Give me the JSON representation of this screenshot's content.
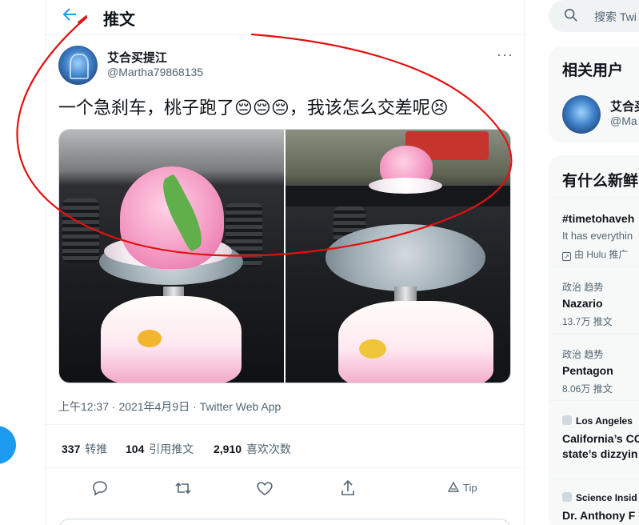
{
  "header": {
    "title": "推文"
  },
  "tweet": {
    "author_name": "艾合买提江",
    "author_handle": "@Martha79868135",
    "more_label": "···",
    "text": "一个急刹车，桃子跑了😔😔😔，我该怎么交差呢😣",
    "timestamp": "上午12:37 · 2021年4月9日 · Twitter Web App",
    "stats": {
      "retweets_value": "337",
      "retweets_label": "转推",
      "quotes_value": "104",
      "quotes_label": "引用推文",
      "likes_value": "2,910",
      "likes_label": "喜欢次数"
    },
    "actions": {
      "reply_icon": "reply-icon",
      "retweet_icon": "retweet-icon",
      "like_icon": "heart-icon",
      "share_icon": "share-icon",
      "tip_label": "Tip"
    }
  },
  "sidebar": {
    "search_placeholder": "搜索 Twi",
    "related_title": "相关用户",
    "related_user": {
      "name": "艾合买",
      "handle": "@Ma"
    },
    "trends_title": "有什么新鲜",
    "trends": [
      {
        "title": "#timetohaveh",
        "sub": "It has everythin",
        "promo": "由 Hulu 推广"
      },
      {
        "meta": "政治 趋势",
        "title": "Nazario",
        "sub": "13.7万 推文"
      },
      {
        "meta": "政治 趋势",
        "title": "Pentagon",
        "sub": "8.06万 推文"
      },
      {
        "source": "Los Angeles",
        "title": "California’s CC",
        "sub": "state’s dizzyin"
      },
      {
        "source": "Science Insid",
        "title": "Dr. Anthony F"
      }
    ]
  },
  "colors": {
    "accent": "#1d9bf0",
    "annotation_red": "#e31010",
    "muted": "#536471"
  }
}
